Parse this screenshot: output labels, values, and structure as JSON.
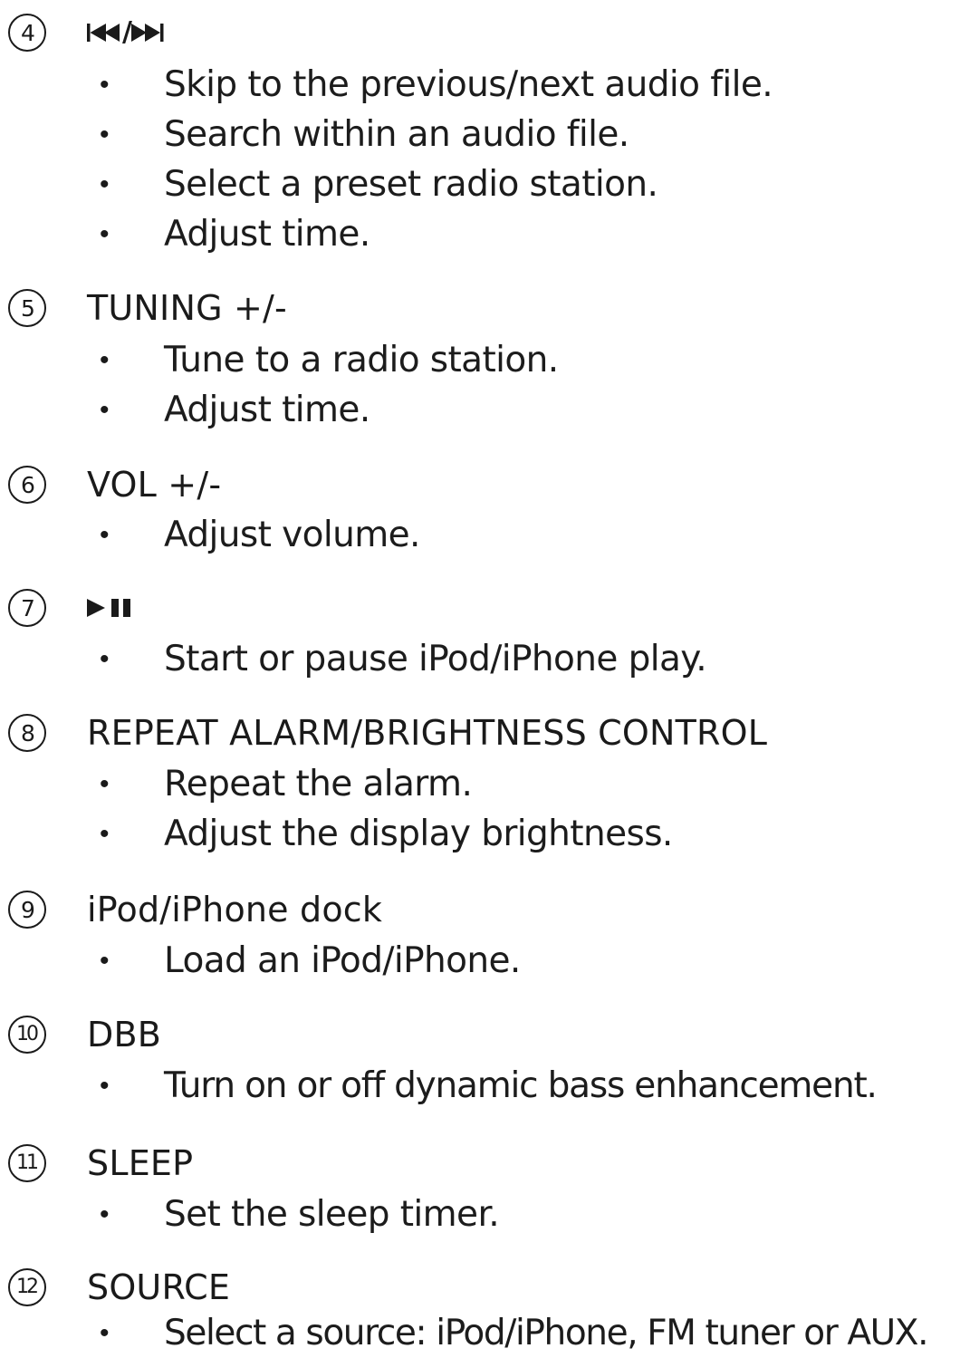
{
  "items": [
    {
      "number": "4",
      "title_icons": [
        "previous-track-icon",
        "next-track-icon"
      ],
      "title_separator": "/",
      "bullet_symbol": "•",
      "bullets": [
        "Skip to the previous/next audio file.",
        "Search within an audio file.",
        "Select a preset radio station.",
        "Adjust time."
      ]
    },
    {
      "number": "5",
      "title": "TUNING +/-",
      "bullet_symbol": "•",
      "bullets": [
        "Tune to a radio station.",
        "Adjust time."
      ]
    },
    {
      "number": "6",
      "title": "VOL +/-",
      "bullet_symbol": "•",
      "bullets": [
        "Adjust volume."
      ]
    },
    {
      "number": "7",
      "title_icons": [
        "play-pause-icon"
      ],
      "bullet_symbol": "•",
      "bullets": [
        "Start or pause iPod/iPhone play."
      ]
    },
    {
      "number": "8",
      "title": "REPEAT ALARM/BRIGHTNESS CONTROL",
      "bullet_symbol": "•",
      "bullets": [
        "Repeat the alarm.",
        "Adjust the display brightness."
      ]
    },
    {
      "number": "9",
      "title": "iPod/iPhone dock",
      "bullet_symbol": "•",
      "bullets": [
        "Load an iPod/iPhone."
      ]
    },
    {
      "number": "10",
      "title": "DBB",
      "bullet_symbol": "•",
      "bullets": [
        "Turn on or off dynamic bass enhancement."
      ]
    },
    {
      "number": "11",
      "title": "SLEEP",
      "bullet_symbol": "•",
      "bullets": [
        "Set the sleep timer."
      ]
    },
    {
      "number": "12",
      "title": "SOURCE",
      "bullet_symbol": "•",
      "bullets": [
        "Select a source: iPod/iPhone, FM tuner or AUX."
      ]
    }
  ]
}
